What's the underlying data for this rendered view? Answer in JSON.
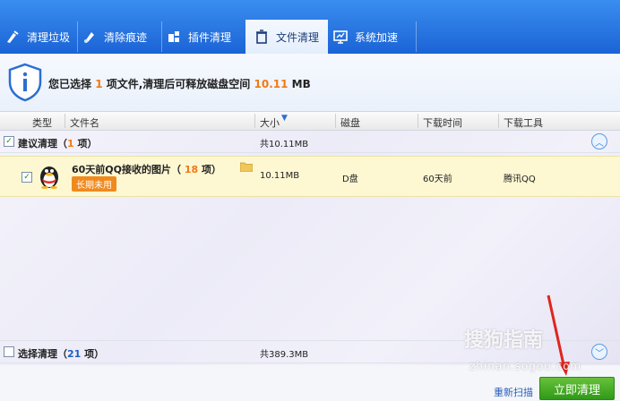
{
  "tabs": [
    {
      "label": "清理垃圾",
      "icon": "broom-icon"
    },
    {
      "label": "清除痕迹",
      "icon": "trace-icon"
    },
    {
      "label": "插件清理",
      "icon": "plugin-icon"
    },
    {
      "label": "文件清理",
      "icon": "trash-icon"
    },
    {
      "label": "系统加速",
      "icon": "monitor-icon"
    }
  ],
  "info": {
    "prefix": "您已选择",
    "count": "1",
    "middle": "项文件,清理后可释放磁盘空间",
    "size": "10.11",
    "unit": "MB"
  },
  "columns": [
    "类型",
    "文件名",
    "大小",
    "磁盘",
    "下载时间",
    "下载工具"
  ],
  "groups": {
    "recommended": {
      "label": "建议清理",
      "count": "1",
      "unit": "项",
      "total": "共10.11MB"
    },
    "optional": {
      "label": "选择清理",
      "count": "21",
      "unit": "项",
      "total": "共389.3MB"
    }
  },
  "item": {
    "name": "60天前QQ接收的图片",
    "count": "18",
    "unit": "项",
    "badge": "长期未用",
    "size": "10.11MB",
    "disk": "D盘",
    "time": "60天前",
    "tool": "腾讯QQ"
  },
  "footer": {
    "rescan": "重新扫描",
    "clean": "立即清理"
  },
  "watermark": {
    "brand": "搜狗指南",
    "url": "zhinan.sogou.com"
  }
}
